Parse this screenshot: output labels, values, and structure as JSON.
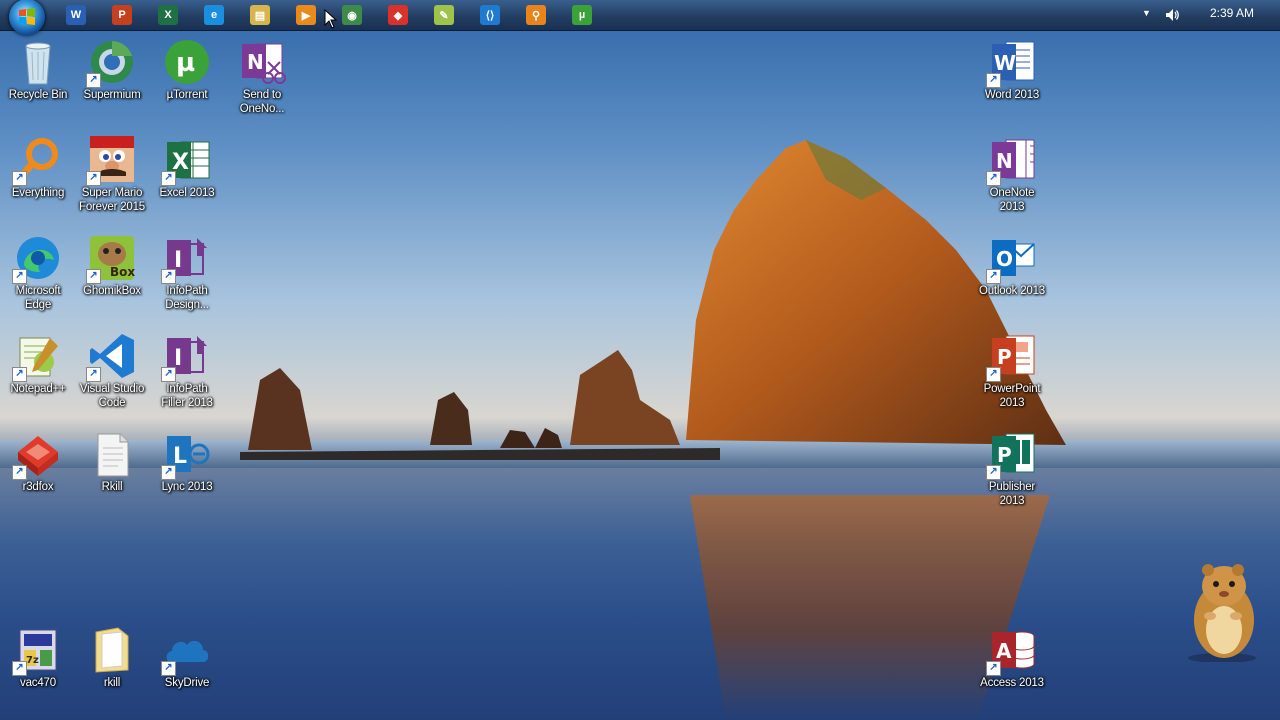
{
  "taskbar": {
    "start_button": "start-orb",
    "pinned_apps": [
      {
        "name": "word",
        "glyph": "W",
        "color": "#2b5fb4"
      },
      {
        "name": "powerpoint",
        "glyph": "P",
        "color": "#c6401f"
      },
      {
        "name": "excel",
        "glyph": "X",
        "color": "#1e7145"
      },
      {
        "name": "internet-explorer",
        "glyph": "e",
        "color": "#1a8fe0"
      },
      {
        "name": "file-explorer",
        "glyph": "▤",
        "color": "#d8b54a"
      },
      {
        "name": "media-player",
        "glyph": "▶",
        "color": "#e98a1c"
      },
      {
        "name": "app-green",
        "glyph": "◉",
        "color": "#3d8a4a"
      },
      {
        "name": "r3dfox",
        "glyph": "◆",
        "color": "#d8322a"
      },
      {
        "name": "notepad",
        "glyph": "✎",
        "color": "#9fc34a"
      },
      {
        "name": "vscode",
        "glyph": "⟨⟩",
        "color": "#1f7ad1"
      },
      {
        "name": "everything-search",
        "glyph": "⚲",
        "color": "#e8841c"
      },
      {
        "name": "utorrent",
        "glyph": "µ",
        "color": "#3aa238"
      }
    ],
    "clock": "2:39 AM"
  },
  "desktop_icons": {
    "col1": [
      {
        "label": "Recycle Bin",
        "icon": "recycle-bin-icon"
      },
      {
        "label": "Everything",
        "icon": "everything-icon"
      },
      {
        "label": "Microsoft\nEdge",
        "icon": "edge-icon"
      },
      {
        "label": "Notepad++",
        "icon": "notepadpp-icon"
      },
      {
        "label": "r3dfox",
        "icon": "r3dfox-icon"
      },
      {
        "label": "vac470",
        "icon": "vac470-icon"
      }
    ],
    "col2": [
      {
        "label": "Supermium",
        "icon": "supermium-icon"
      },
      {
        "label": "Super Mario\nForever 2015",
        "icon": "super-mario-icon"
      },
      {
        "label": "GhomikBox",
        "icon": "ghomikbox-icon"
      },
      {
        "label": "Visual Studio\nCode",
        "icon": "vscode-icon"
      },
      {
        "label": "Rkill",
        "icon": "rkill-file-icon"
      },
      {
        "label": "rkill",
        "icon": "rkill-folder-icon"
      }
    ],
    "col3": [
      {
        "label": "µTorrent",
        "icon": "utorrent-icon"
      },
      {
        "label": "Excel 2013",
        "icon": "excel-icon"
      },
      {
        "label": "InfoPath\nDesign...",
        "icon": "infopath-designer-icon"
      },
      {
        "label": "InfoPath\nFiller 2013",
        "icon": "infopath-filler-icon"
      },
      {
        "label": "Lync 2013",
        "icon": "lync-icon"
      },
      {
        "label": "SkyDrive",
        "icon": "skydrive-icon"
      }
    ],
    "col4": [
      {
        "label": "Send to\nOneNo...",
        "icon": "send-to-onenote-icon"
      }
    ],
    "right": [
      {
        "label": "Word 2013",
        "icon": "word-icon"
      },
      {
        "label": "OneNote\n2013",
        "icon": "onenote-icon"
      },
      {
        "label": "Outlook 2013",
        "icon": "outlook-icon"
      },
      {
        "label": "PowerPoint\n2013",
        "icon": "powerpoint-icon"
      },
      {
        "label": "Publisher\n2013",
        "icon": "publisher-icon"
      },
      {
        "label": "Access 2013",
        "icon": "access-icon"
      }
    ]
  },
  "colors": {
    "word": "#2b5fb4",
    "excel": "#1e7145",
    "onenote": "#7b3a96",
    "infopath": "#77398e",
    "outlook": "#0b6cc2",
    "powerpoint": "#c6401f",
    "publisher": "#12735c",
    "access": "#a8262b",
    "lync": "#1f74c0"
  }
}
